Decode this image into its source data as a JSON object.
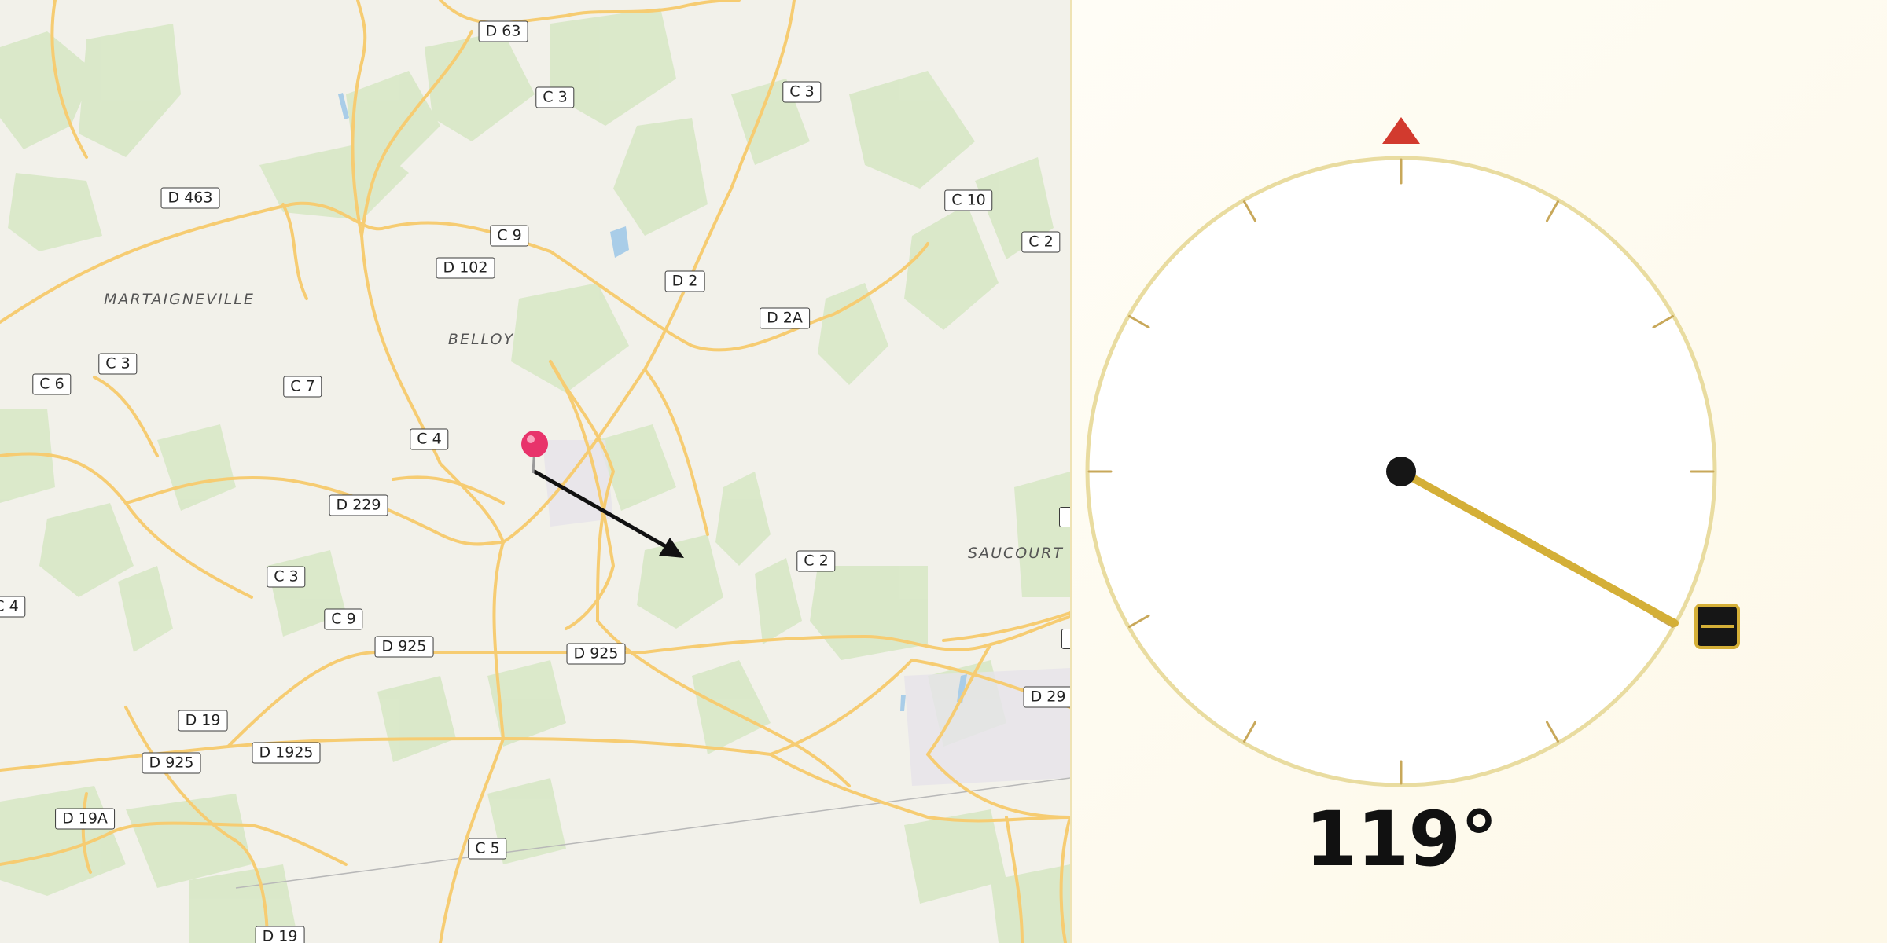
{
  "map": {
    "road_labels": [
      {
        "id": "d63",
        "text": "D 63"
      },
      {
        "id": "c3-a",
        "text": "C 3"
      },
      {
        "id": "c3-b",
        "text": "C 3"
      },
      {
        "id": "d463",
        "text": "D 463"
      },
      {
        "id": "c10",
        "text": "C 10"
      },
      {
        "id": "c9-a",
        "text": "C 9"
      },
      {
        "id": "c2-a",
        "text": "C 2"
      },
      {
        "id": "d102",
        "text": "D 102"
      },
      {
        "id": "d2",
        "text": "D 2"
      },
      {
        "id": "d2a",
        "text": "D 2A"
      },
      {
        "id": "c3-c",
        "text": "C 3"
      },
      {
        "id": "c6",
        "text": "C 6"
      },
      {
        "id": "c7",
        "text": "C 7"
      },
      {
        "id": "c4-a",
        "text": "C 4"
      },
      {
        "id": "d229",
        "text": "D 229"
      },
      {
        "id": "c2-b",
        "text": "C 2"
      },
      {
        "id": "c3-d",
        "text": "C 3"
      },
      {
        "id": "c4-b",
        "text": "C 4"
      },
      {
        "id": "c9-b",
        "text": "C 9"
      },
      {
        "id": "d925-a",
        "text": "D 925"
      },
      {
        "id": "d925-b",
        "text": "D 925"
      },
      {
        "id": "d29",
        "text": "D 29"
      },
      {
        "id": "d19",
        "text": "D 19"
      },
      {
        "id": "d1925",
        "text": "D 1925"
      },
      {
        "id": "d925-c",
        "text": "D 925"
      },
      {
        "id": "d19a",
        "text": "D 19A"
      },
      {
        "id": "c5",
        "text": "C 5"
      },
      {
        "id": "d19-b",
        "text": "D 19"
      }
    ],
    "place_labels": [
      {
        "id": "martaigneville",
        "text": "MARTAIGNEVILLE"
      },
      {
        "id": "belloy",
        "text": "BELLOY"
      },
      {
        "id": "saucourt",
        "text": "SAUCOURT"
      }
    ],
    "pin_color": "#e8336b",
    "arrow_color": "#111111"
  },
  "compass": {
    "heading_deg": 119,
    "heading_label": "119°",
    "north_marker_color": "#d23a2e",
    "needle_color": "#d4af37",
    "ring_color": "#e9dca0"
  }
}
